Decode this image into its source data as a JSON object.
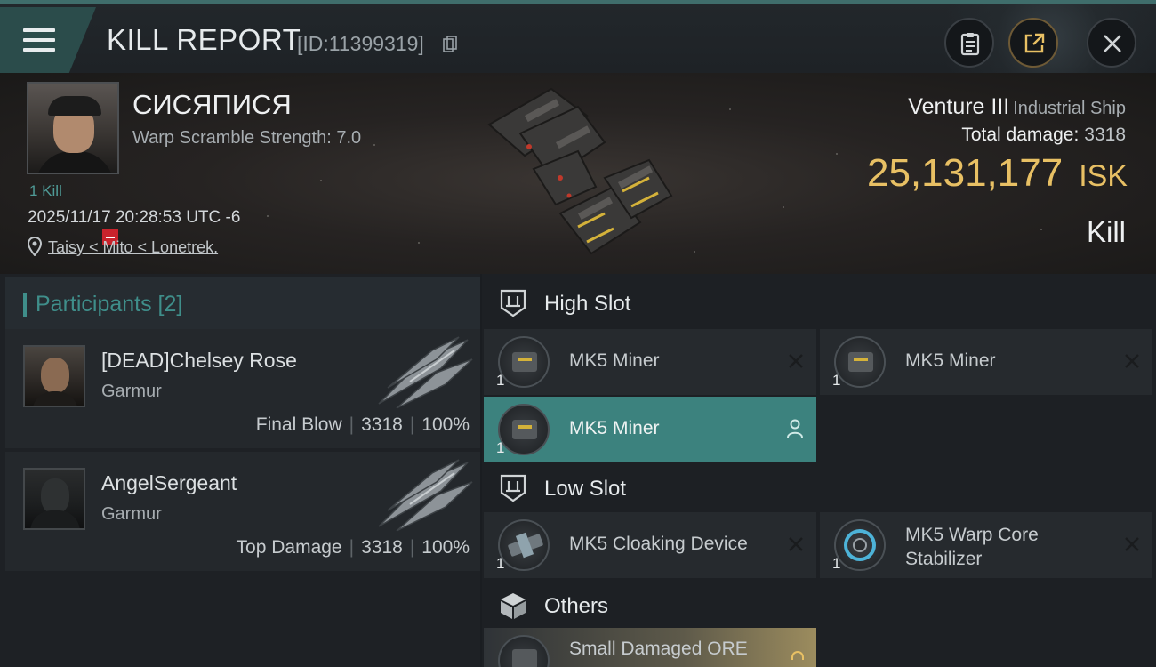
{
  "header": {
    "title": "KILL REPORT",
    "report_id": "[ID:11399319]"
  },
  "victim": {
    "name": "СИСЯПИСЯ",
    "warp_scramble": "Warp Scramble Strength: 7.0",
    "kills": "1 Kill",
    "datetime": "2025/11/17 20:28:53 UTC -6",
    "location": "Taisy < Mito < Lonetrek.",
    "ship_name": "Venture III",
    "ship_class": "Industrial Ship",
    "total_damage_label": "Total damage:",
    "total_damage_value": "3318",
    "isk_value": "25,131,177",
    "isk_unit": "ISK",
    "result": "Kill"
  },
  "participants": {
    "header": "Participants [2]",
    "items": [
      {
        "name": "[DEAD]Chelsey Rose",
        "ship": "Garmur",
        "role": "Final Blow",
        "damage": "3318",
        "percent": "100%"
      },
      {
        "name": "AngelSergeant",
        "ship": "Garmur",
        "role": "Top Damage",
        "damage": "3318",
        "percent": "100%"
      }
    ]
  },
  "slots": {
    "high": {
      "label": "High Slot",
      "items": [
        {
          "name": "MK5 Miner",
          "qty": "1"
        },
        {
          "name": "MK5 Miner",
          "qty": "1"
        },
        {
          "name": "MK5 Miner",
          "qty": "1"
        }
      ]
    },
    "low": {
      "label": "Low Slot",
      "items": [
        {
          "name": "MK5 Cloaking Device",
          "qty": "1"
        },
        {
          "name_line1": "MK5 Warp Core",
          "name_line2": "Stabilizer",
          "qty": "1"
        }
      ]
    },
    "others": {
      "label": "Others",
      "items": [
        {
          "name": "Small Damaged ORE"
        }
      ]
    }
  },
  "colors": {
    "accent_teal": "#3f8e8a",
    "isk_gold": "#e8c064",
    "active_module": "#3c827e",
    "security_red": "#c8232c"
  }
}
